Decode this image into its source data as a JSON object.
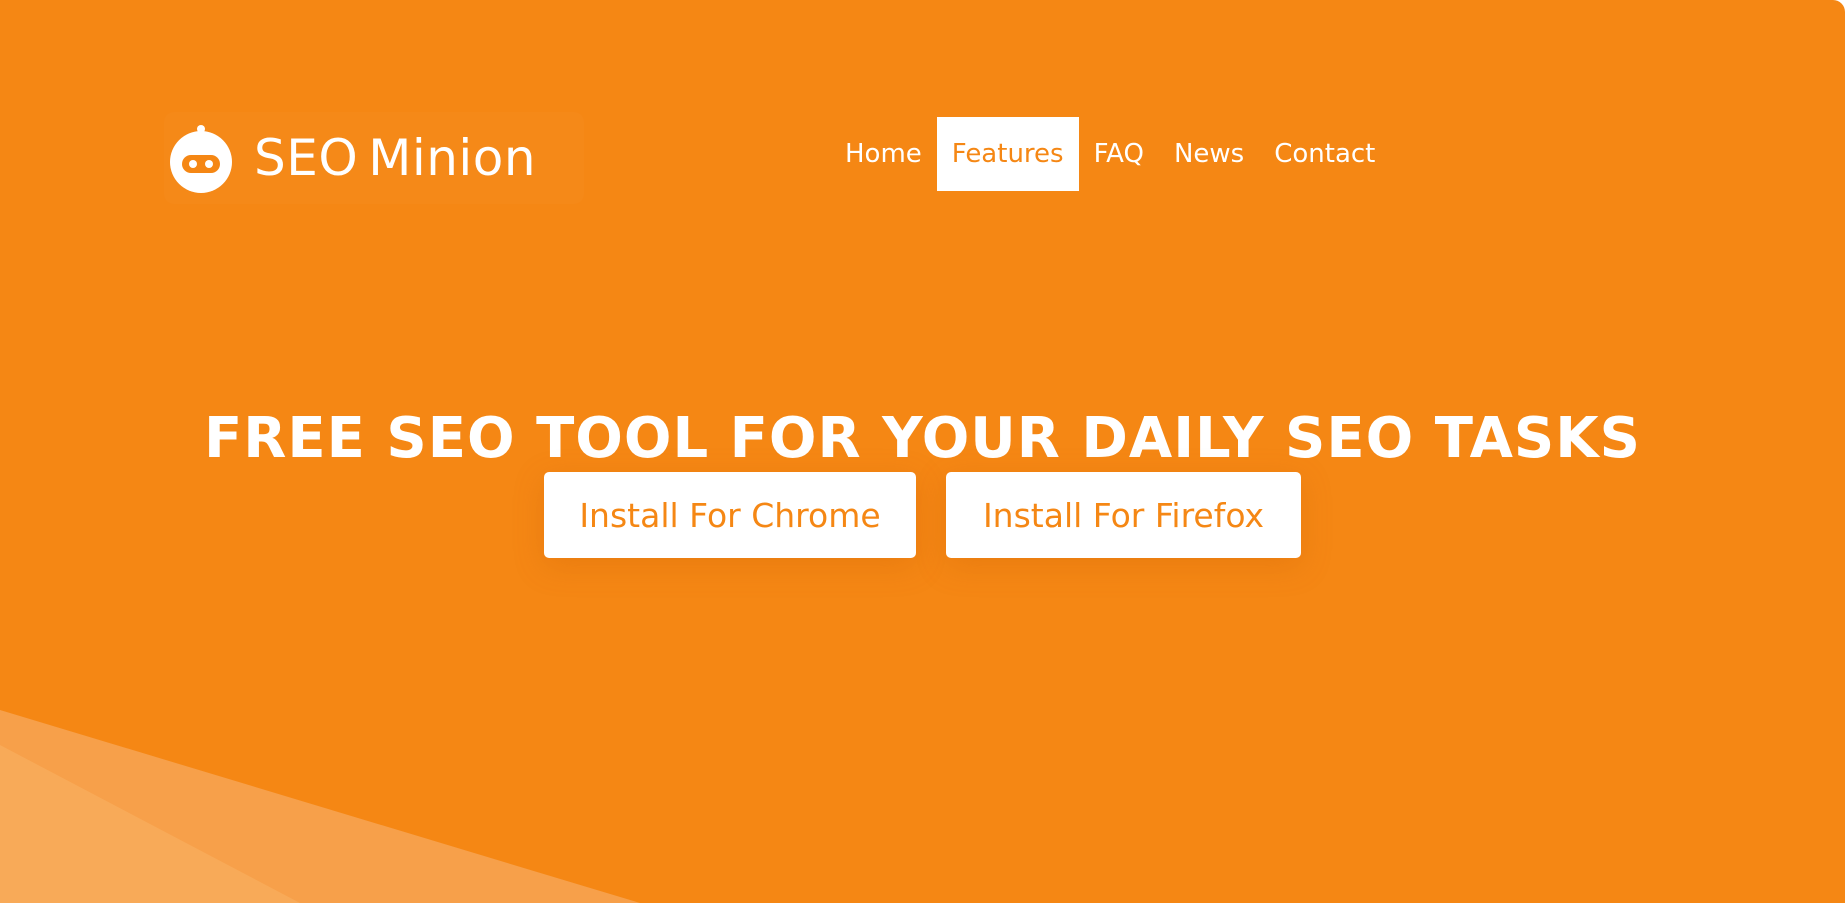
{
  "brand": {
    "name_part1": "SEO",
    "name_part2": "Minion",
    "icon": "robot-icon"
  },
  "nav": {
    "items": [
      {
        "label": "Home",
        "active": false
      },
      {
        "label": "Features",
        "active": true
      },
      {
        "label": "FAQ",
        "active": false
      },
      {
        "label": "News",
        "active": false
      },
      {
        "label": "Contact",
        "active": false
      }
    ]
  },
  "hero": {
    "headline": "FREE SEO TOOL FOR YOUR DAILY SEO TASKS",
    "buttons": {
      "chrome": "Install For Chrome",
      "firefox": "Install For Firefox"
    }
  },
  "colors": {
    "accent": "#f58714",
    "text_on_accent": "#ffffff"
  }
}
